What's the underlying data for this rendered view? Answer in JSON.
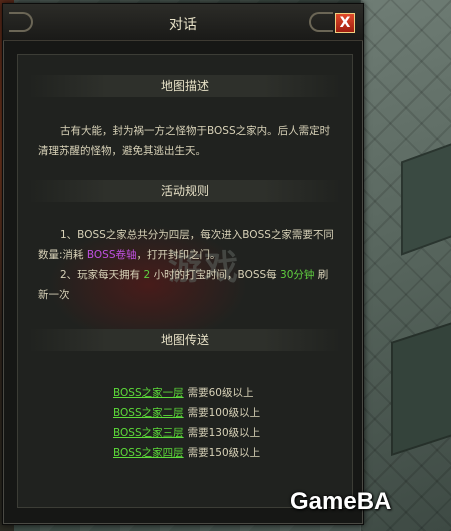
{
  "dialog": {
    "title": "对话",
    "close_label": "X"
  },
  "map_desc": {
    "heading": "地图描述",
    "text": "古有大能，封为祸一方之怪物于BOSS之家内。后人需定时清理苏醒的怪物，避免其逃出生天。"
  },
  "rules": {
    "heading": "活动规则",
    "rule1_prefix": "1、BOSS之家总共分为四层，每次进入BOSS之家需要不同数量:消耗",
    "rule1_item": "BOSS卷轴",
    "rule1_suffix": "，打开封印之门。",
    "rule2_prefix": "2、玩家每天拥有",
    "rule2_hours": "2",
    "rule2_mid": "小时的打宝时间，BOSS每",
    "rule2_minutes": "30分钟",
    "rule2_suffix": "刷新一次"
  },
  "teleport": {
    "heading": "地图传送",
    "items": [
      {
        "label": "BOSS之家一层",
        "req": "需要60级以上"
      },
      {
        "label": "BOSS之家二层",
        "req": "需要100级以上"
      },
      {
        "label": "BOSS之家三层",
        "req": "需要130级以上"
      },
      {
        "label": "BOSS之家四层",
        "req": "需要150级以上"
      }
    ]
  },
  "watermark": "游戏",
  "brand": "GameBA"
}
